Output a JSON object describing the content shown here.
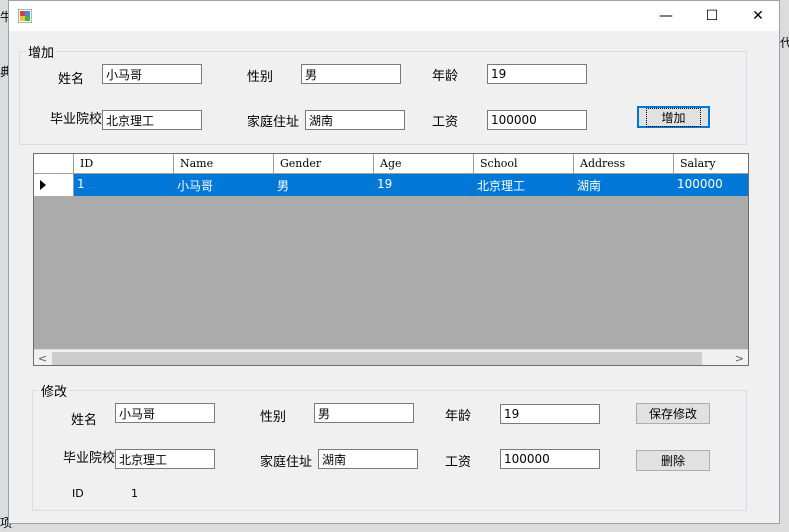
{
  "background": {
    "fragments": [
      "牛",
      "典",
      "代",
      "项"
    ]
  },
  "window": {
    "title": "",
    "minimize_glyph": "—",
    "maximize_glyph": "☐",
    "close_glyph": "✕"
  },
  "add_group": {
    "title": "增加",
    "name_label": "姓名",
    "name_value": "小马哥",
    "gender_label": "性别",
    "gender_value": "男",
    "age_label": "年龄",
    "age_value": "19",
    "school_label": "毕业院校",
    "school_value": "北京理工",
    "address_label": "家庭住址",
    "address_value": "湖南",
    "salary_label": "工资",
    "salary_value": "100000",
    "add_button": "增加"
  },
  "grid": {
    "columns": [
      "ID",
      "Name",
      "Gender",
      "Age",
      "School",
      "Address",
      "Salary"
    ],
    "rows": [
      [
        "1",
        "小马哥",
        "男",
        "19",
        "北京理工",
        "湖南",
        "100000"
      ]
    ],
    "scroll_left": "<",
    "scroll_right": ">"
  },
  "edit_group": {
    "title": "修改",
    "name_label": "姓名",
    "name_value": "小马哥",
    "gender_label": "性别",
    "gender_value": "男",
    "age_label": "年龄",
    "age_value": "19",
    "school_label": "毕业院校",
    "school_value": "北京理工",
    "address_label": "家庭住址",
    "address_value": "湖南",
    "salary_label": "工资",
    "salary_value": "100000",
    "save_button": "保存修改",
    "delete_button": "删除",
    "id_label": "ID",
    "id_value": "1"
  }
}
